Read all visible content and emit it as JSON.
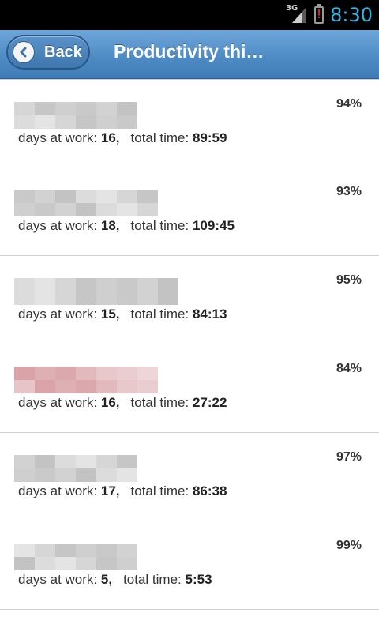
{
  "status_bar": {
    "network": "3G",
    "time": "8:30",
    "icons": [
      "signal-icon",
      "battery-alert-icon"
    ]
  },
  "header": {
    "back_label": "Back",
    "title": "Productivity thi…"
  },
  "labels": {
    "days_label": "days at work:",
    "time_label": "total time:"
  },
  "colors": {
    "header": "#4f8cc5",
    "clock": "#33b5e5",
    "name_blur_gray": "#c9c9c9",
    "name_blur_red": "#dba9ad"
  },
  "items": [
    {
      "percent": "94%",
      "days": "16,",
      "time": "89:59",
      "blur": "gray"
    },
    {
      "percent": "93%",
      "days": "18,",
      "time": "109:45",
      "blur": "gray"
    },
    {
      "percent": "95%",
      "days": "15,",
      "time": "84:13",
      "blur": "gray"
    },
    {
      "percent": "84%",
      "days": "16,",
      "time": "27:22",
      "blur": "red"
    },
    {
      "percent": "97%",
      "days": "17,",
      "time": "86:38",
      "blur": "gray"
    },
    {
      "percent": "99%",
      "days": "5,",
      "time": "5:53",
      "blur": "gray"
    }
  ]
}
